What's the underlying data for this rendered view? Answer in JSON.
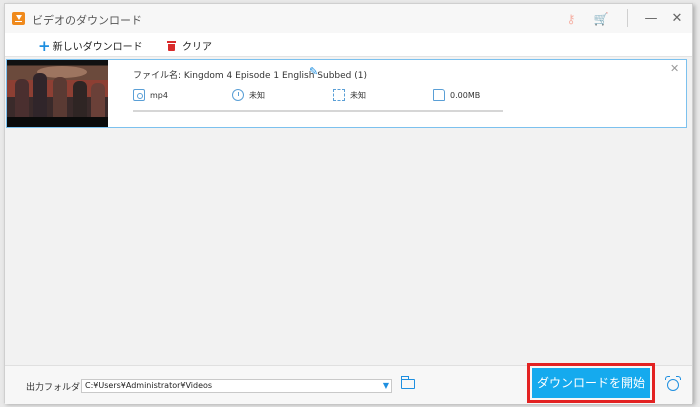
{
  "window": {
    "title": "ビデオのダウンロード",
    "icons": {
      "app": "download-app-icon",
      "key": "key-icon",
      "cart": "cart-icon",
      "minimize": "minimize-icon",
      "close": "close-icon"
    },
    "minimize_glyph": "—",
    "close_glyph": "✕"
  },
  "toolbar": {
    "new_download_label": "新しいダウンロード",
    "clear_label": "クリア"
  },
  "download_item": {
    "filename_label": "ファイル名: Kingdom 4 Episode 1 English Subbed (1)",
    "format": "mp4",
    "duration": "未知",
    "resolution": "未知",
    "size": "0.00MB",
    "progress": 0
  },
  "bottom": {
    "output_folder_label": "出力フォルダ：",
    "output_path": "C:¥Users¥Administrator¥Videos",
    "start_button_label": "ダウンロードを開始"
  },
  "colors": {
    "accent": "#1e8fe0",
    "start_button": "#15aaee",
    "highlight_frame": "#e32222",
    "app_icon": "#f08a1c"
  }
}
